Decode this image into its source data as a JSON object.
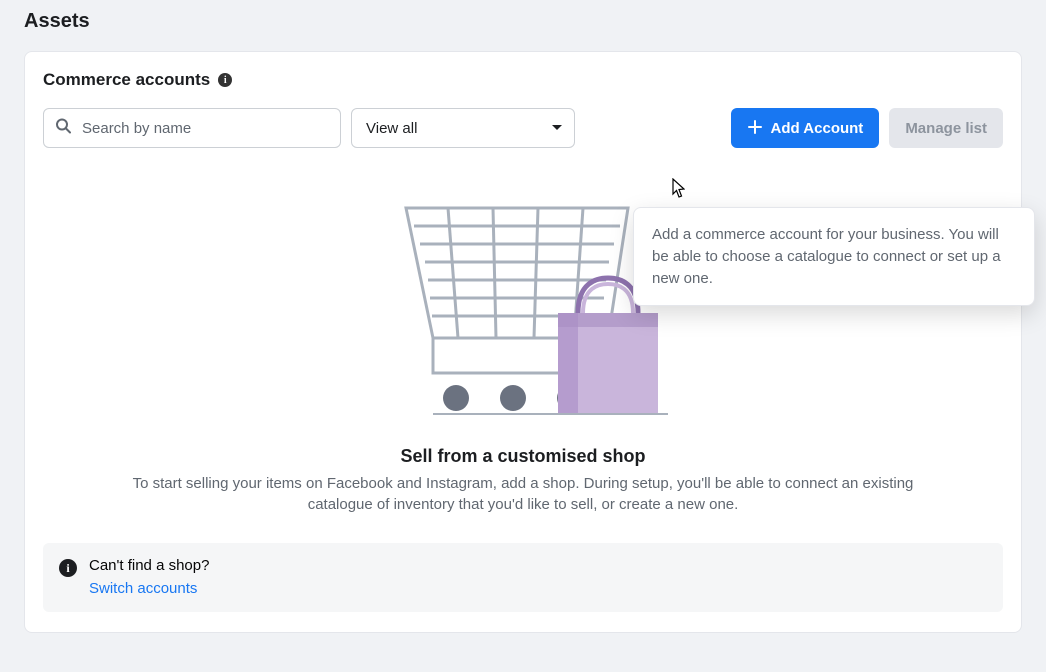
{
  "page": {
    "title": "Assets"
  },
  "card": {
    "title": "Commerce accounts",
    "search_placeholder": "Search by name",
    "filter": {
      "selected": "View all"
    },
    "add_button": "Add Account",
    "manage_button": "Manage list",
    "tooltip": "Add a commerce account for your business. You will be able to choose a catalogue to connect or set up a new one.",
    "empty": {
      "title": "Sell from a customised shop",
      "description": "To start selling your items on Facebook and Instagram, add a shop. During setup, you'll be able to connect an existing catalogue of inventory that you'd like to sell, or create a new one."
    },
    "banner": {
      "title": "Can't find a shop?",
      "link": "Switch accounts"
    }
  },
  "colors": {
    "primary": "#1877f2"
  }
}
